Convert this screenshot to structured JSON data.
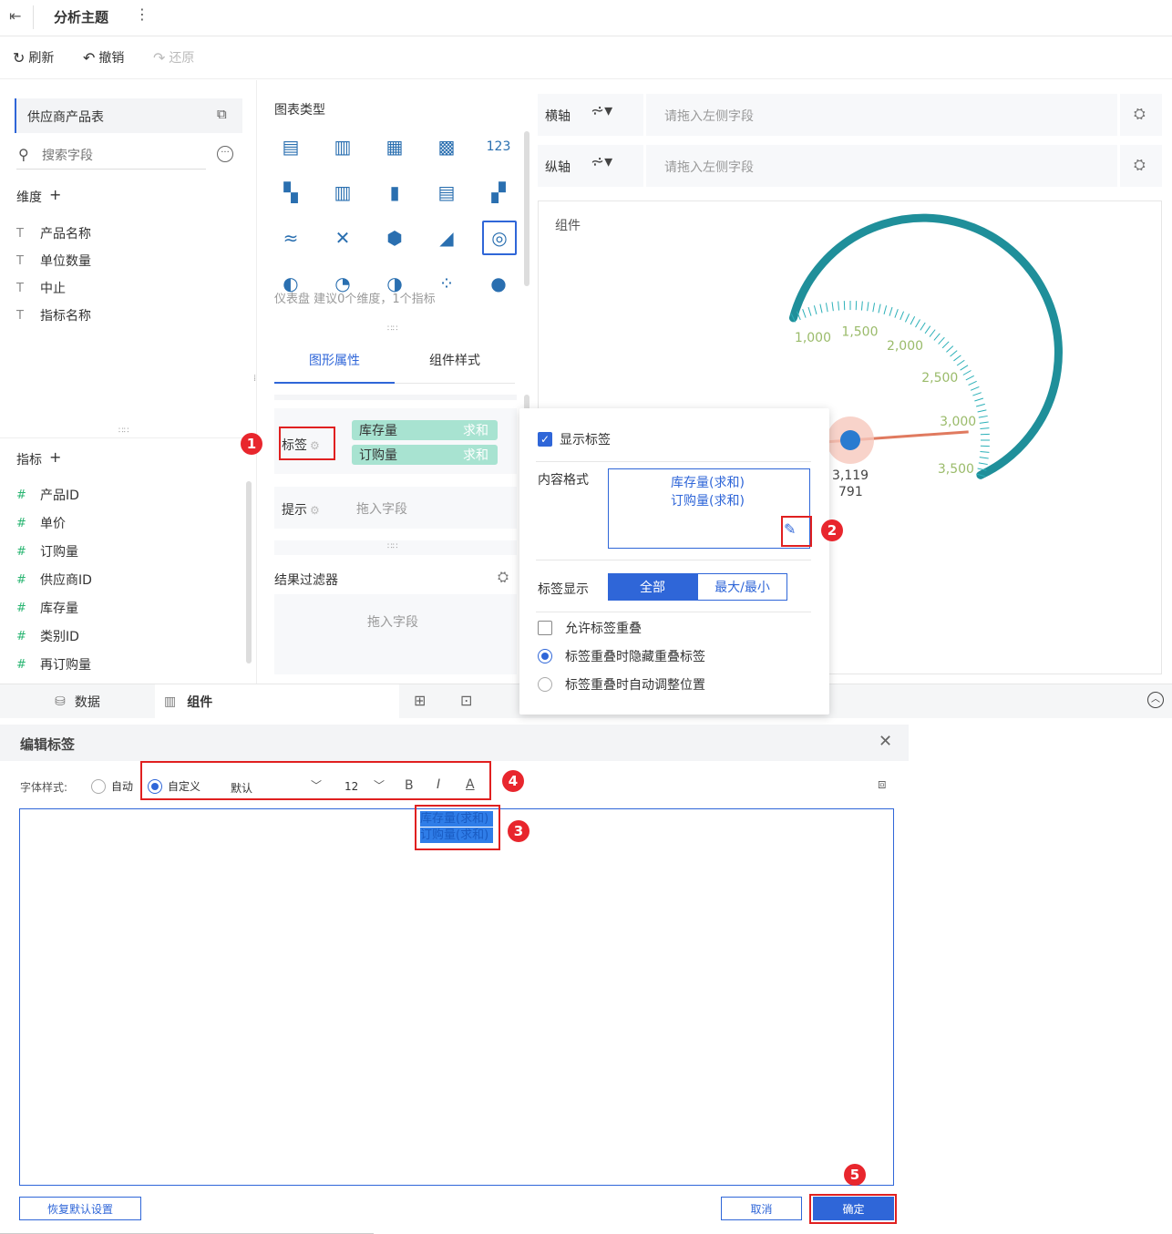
{
  "topbar": {
    "title": "分析主题"
  },
  "toolbar": {
    "refresh": "刷新",
    "undo": "撤销",
    "redo": "还原"
  },
  "left": {
    "table_name": "供应商产品表",
    "search_placeholder": "搜索字段",
    "dimension_title": "维度",
    "dimensions": [
      "产品名称",
      "单位数量",
      "中止",
      "指标名称"
    ],
    "measure_title": "指标",
    "measures": [
      "产品ID",
      "单价",
      "订购量",
      "供应商ID",
      "库存量",
      "类别ID",
      "再订购量"
    ]
  },
  "mid": {
    "chart_type_title": "图表类型",
    "number_icon_text": "123",
    "chart_hint": "仪表盘 建议0个维度，1个指标",
    "tab_graph": "图形属性",
    "tab_style": "组件样式",
    "label_title": "标签",
    "chip1_name": "库存量",
    "chip1_agg": "求和",
    "chip2_name": "订购量",
    "chip2_agg": "求和",
    "tip_title": "提示",
    "drop_field": "拖入字段",
    "filter_title": "结果过滤器",
    "filter_drop": "拖入字段"
  },
  "axis": {
    "x_label": "横轴",
    "y_label": "纵轴",
    "placeholder": "请拖入左侧字段"
  },
  "canvas": {
    "title": "组件",
    "value1": "3,119",
    "value2": "791"
  },
  "chart_data": {
    "type": "gauge",
    "min": 0,
    "max": 3500,
    "tick_labels": [
      "1,000",
      "1,500",
      "2,000",
      "2,500",
      "3,000",
      "3,500"
    ],
    "value_labels": [
      "3,119",
      "791"
    ]
  },
  "popup": {
    "show_label": "显示标签",
    "content_format": "内容格式",
    "content_line1": "库存量(求和)",
    "content_line2": "订购量(求和)",
    "label_display": "标签显示",
    "seg_all": "全部",
    "seg_minmax": "最大/最小",
    "allow_overlap": "允许标签重叠",
    "hide_overlap": "标签重叠时隐藏重叠标签",
    "auto_adjust": "标签重叠时自动调整位置"
  },
  "bottom_tabs": {
    "data": "数据",
    "component": "组件"
  },
  "dialog": {
    "title": "编辑标签",
    "font_style_label": "字体样式:",
    "auto": "自动",
    "custom": "自定义",
    "font_select": "默认",
    "size_select": "12",
    "bold": "B",
    "italic": "I",
    "underline": "A",
    "editor_line1": "库存量(求和)",
    "editor_line2": "订购量(求和)",
    "reset": "恢复默认设置",
    "cancel": "取消",
    "ok": "确定"
  },
  "badges": [
    "1",
    "2",
    "3",
    "4",
    "5"
  ],
  "colors": {
    "accent": "#2f66d8",
    "gauge": "#1f8f9a",
    "tick_text": "#9abb6a",
    "chip": "#a8e3d1",
    "annotation": "#e02020"
  }
}
